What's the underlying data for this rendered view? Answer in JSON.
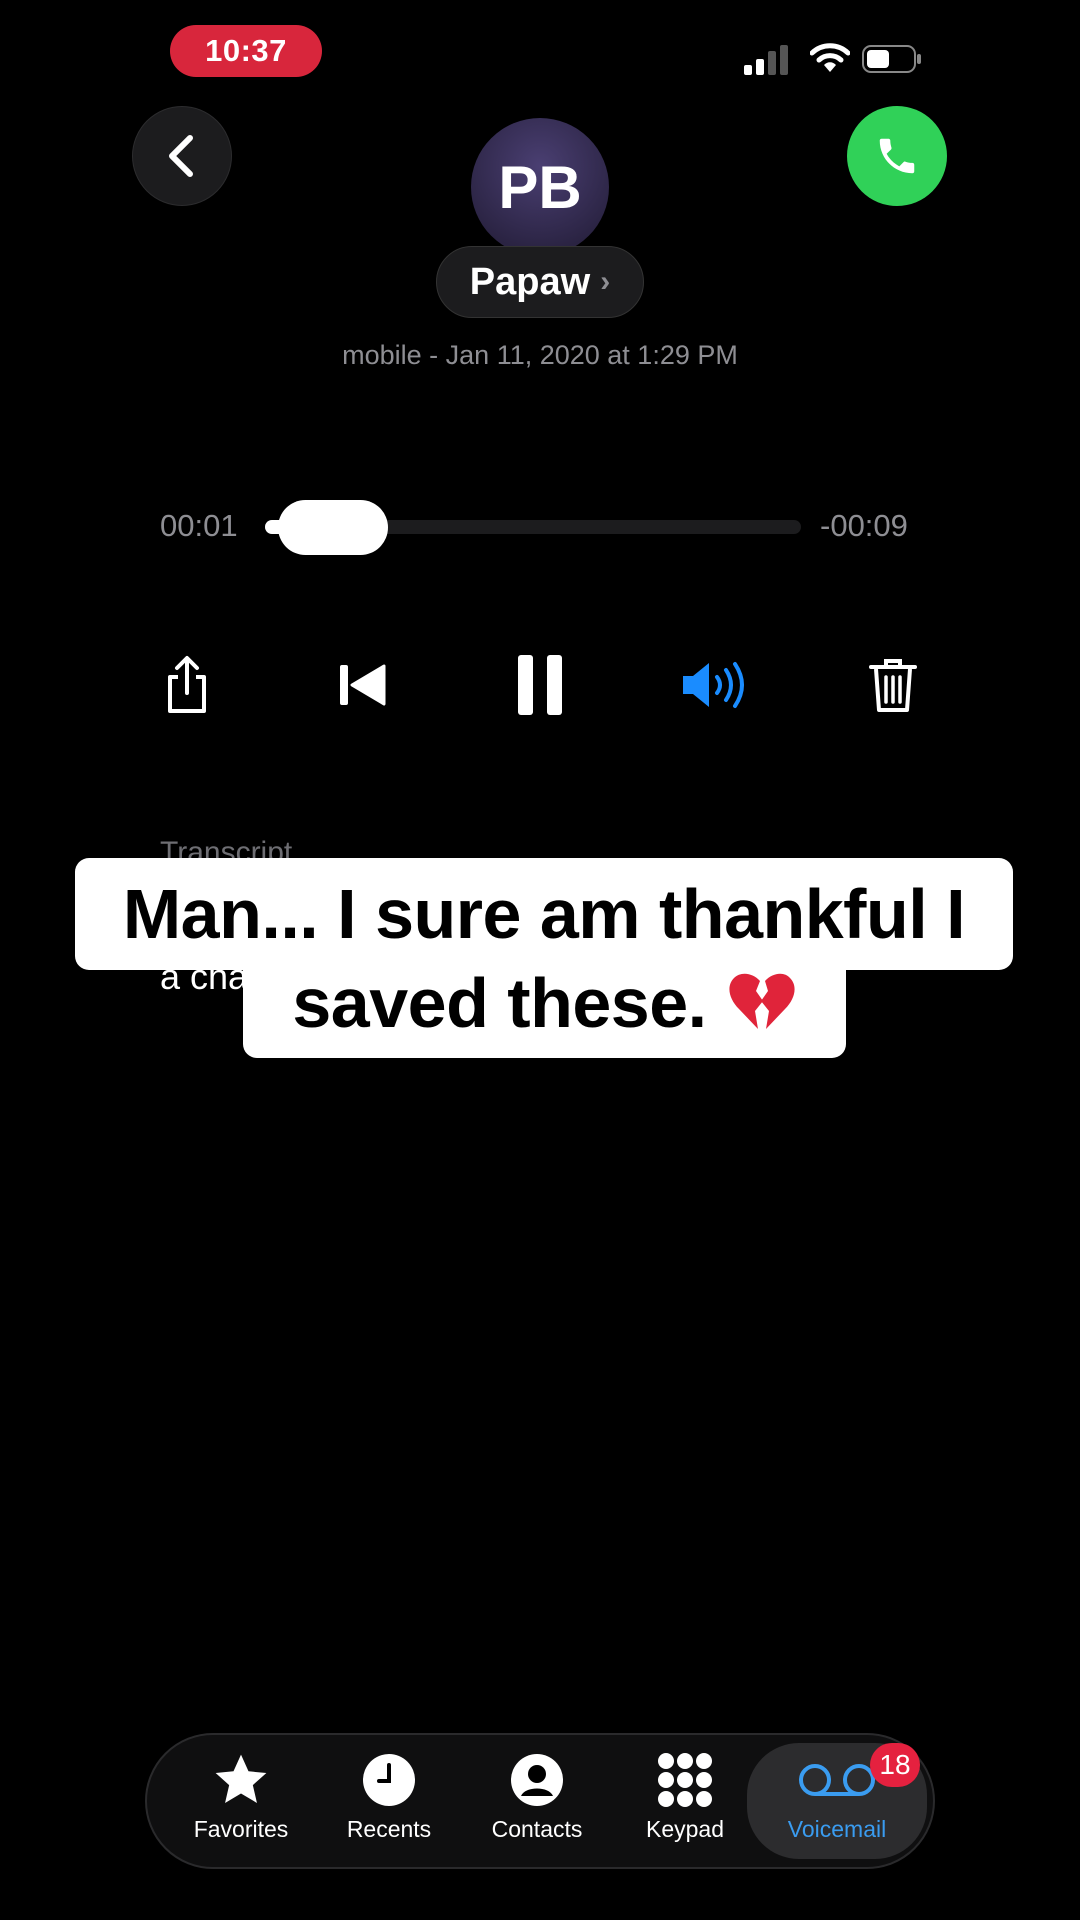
{
  "status_bar": {
    "time": "10:37"
  },
  "contact": {
    "initials": "PB",
    "name": "Papaw",
    "name_chevron": "›",
    "meta": "mobile - Jan 11, 2020 at 1:29 PM"
  },
  "player": {
    "elapsed": "00:01",
    "remaining": "-00:09",
    "progress_fraction": 0.1
  },
  "controls": {
    "icons": [
      "share-icon",
      "skip-back-icon",
      "pause-icon",
      "speaker-icon",
      "trash-icon"
    ],
    "accent_color": "#1a8cff"
  },
  "transcript": {
    "label": "Transcript",
    "visible_text": "a cha"
  },
  "caption": {
    "line1": "Man... I sure am thankful I",
    "line2": "saved these.",
    "emoji": "broken-heart-icon"
  },
  "tabbar": {
    "tabs": [
      {
        "label": "Favorites",
        "icon": "star-icon"
      },
      {
        "label": "Recents",
        "icon": "clock-icon"
      },
      {
        "label": "Contacts",
        "icon": "person-circle-icon"
      },
      {
        "label": "Keypad",
        "icon": "keypad-icon"
      },
      {
        "label": "Voicemail",
        "icon": "voicemail-icon"
      }
    ],
    "voicemail_badge": "18",
    "active_color": "#3a9cf0"
  },
  "colors": {
    "call_green": "#30d158",
    "recording_red": "#d8263c",
    "badge_red": "#e5213f"
  }
}
